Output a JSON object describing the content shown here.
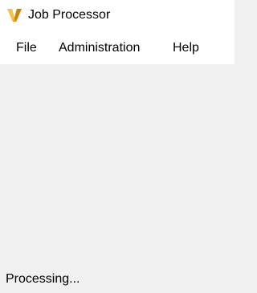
{
  "window": {
    "title": "Job Processor",
    "app_icon": "vault-v-logo-icon",
    "accent_color": "#e8a317"
  },
  "menu": {
    "items": [
      {
        "label": "File"
      },
      {
        "label": "Administration"
      },
      {
        "label": "Help"
      }
    ]
  },
  "status": {
    "text": "Processing..."
  }
}
